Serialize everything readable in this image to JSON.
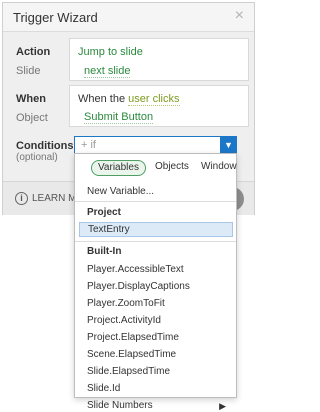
{
  "dialog": {
    "title": "Trigger Wizard",
    "close_label": "×",
    "action": {
      "label": "Action",
      "value": "Jump to slide"
    },
    "slide": {
      "label": "Slide",
      "value": "next slide"
    },
    "when": {
      "label": "When",
      "prefix": "When the",
      "value": "user clicks"
    },
    "object": {
      "label": "Object",
      "value": "Submit Button"
    },
    "conditions": {
      "label": "Conditions",
      "sub_label": "(optional)",
      "placeholder": "+ if"
    },
    "footer": {
      "learn_more": "LEARN MORE",
      "info_icon": "i"
    }
  },
  "dropdown": {
    "tabs": [
      {
        "label": "Variables",
        "active": true
      },
      {
        "label": "Objects",
        "active": false
      },
      {
        "label": "Window",
        "active": false
      }
    ],
    "new_variable": "New Variable...",
    "sections": [
      {
        "title": "Project",
        "items": [
          "TextEntry"
        ]
      },
      {
        "title": "Built-In",
        "items": [
          "Player.AccessibleText",
          "Player.DisplayCaptions",
          "Player.ZoomToFit",
          "Project.ActivityId",
          "Project.ElapsedTime",
          "Scene.ElapsedTime",
          "Slide.ElapsedTime",
          "Slide.Id",
          "Slide Numbers"
        ]
      }
    ],
    "submenu_arrow": "▶",
    "select_arrow": "▼"
  },
  "colors": {
    "accent": "#1c77c9",
    "link": "#2b8a3e",
    "highlight": "#7d9b20",
    "selected_bg": "#dceaf8"
  }
}
